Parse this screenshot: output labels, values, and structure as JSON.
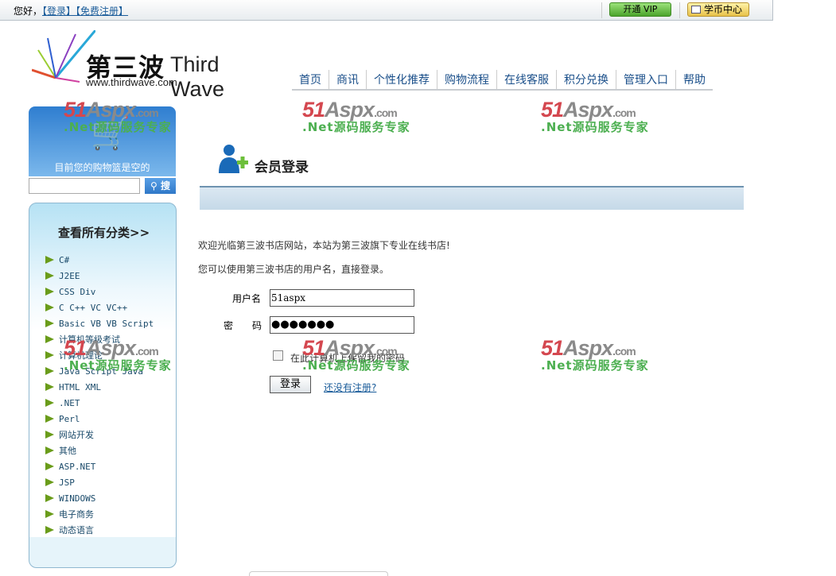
{
  "topbar": {
    "greeting": "您好，",
    "login": "【登录】",
    "register": "【免费注册】",
    "vip": "开通 VIP",
    "coin": "学币中心"
  },
  "logo": {
    "cn": "第三波",
    "en": "Third Wave",
    "url": "www.thirdwave.com"
  },
  "nav": [
    "首页",
    "商讯",
    "个性化推荐",
    "购物流程",
    "在线客服",
    "积分兑换",
    "管理入口",
    "帮助"
  ],
  "watermark": {
    "brand": "51Aspx.com",
    "slogan": ".Net源码服务专家"
  },
  "cart": {
    "text": "目前您的购物篮是空的"
  },
  "search": {
    "value": "",
    "button": "搜"
  },
  "categories": {
    "title": "查看所有分类>>",
    "items": [
      "C#",
      "J2EE",
      "CSS Div",
      "C C++ VC VC++",
      "Basic VB VB Script",
      "计算机等级考试",
      "计算机理论",
      "Java Script Java",
      "HTML XML",
      ".NET",
      "Perl",
      "网站开发",
      "其他",
      "ASP.NET",
      "JSP",
      "WINDOWS",
      "电子商务",
      "动态语言"
    ]
  },
  "login": {
    "title": "会员登录",
    "welcome": "欢迎光临第三波书店网站，本站为第三波旗下专业在线书店!",
    "hint": "您可以使用第三波书店的用户名，直接登录。",
    "username_label": "用户名",
    "username": "51aspx",
    "password_label": "密　　码",
    "password": "●●●●●●●",
    "remember": "在此计算机上保留我的密码",
    "submit": "登录",
    "register_link": "还没有注册?"
  }
}
